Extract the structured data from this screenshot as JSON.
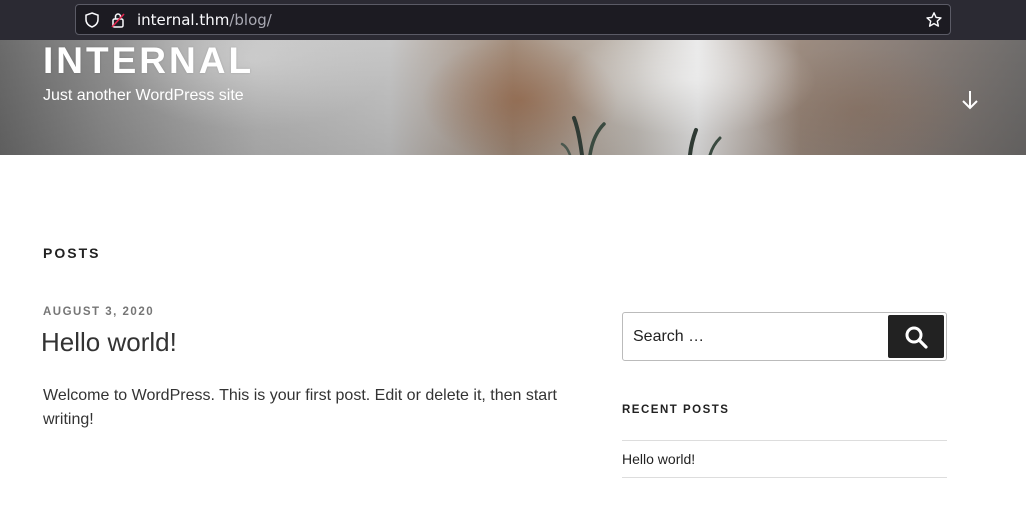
{
  "browser": {
    "url_host": "internal.thm",
    "url_path": "/blog/"
  },
  "header": {
    "site_title": "INTERNAL",
    "tagline": "Just another WordPress site"
  },
  "main": {
    "page_title": "POSTS",
    "posts": [
      {
        "date": "AUGUST 3, 2020",
        "title": "Hello world!",
        "excerpt": "Welcome to WordPress. This is your first post. Edit or delete it, then start writing!"
      }
    ]
  },
  "sidebar": {
    "search": {
      "placeholder": "Search …"
    },
    "recent_posts": {
      "title": "RECENT POSTS",
      "items": [
        {
          "label": "Hello world!"
        }
      ]
    }
  },
  "icons": [
    "shield-icon",
    "lock-icon",
    "star-icon",
    "arrow-down-icon",
    "search-icon"
  ]
}
